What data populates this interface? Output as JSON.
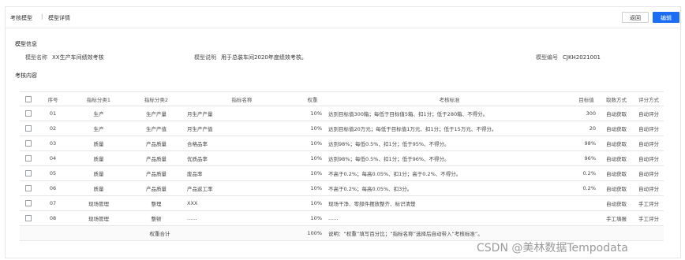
{
  "breadcrumb": {
    "item1": "考核模型",
    "separator": "|",
    "item2": "模型详情"
  },
  "actions": {
    "back_label": "返回",
    "edit_label": "编辑"
  },
  "sections": {
    "model_info": "模型信息",
    "assessment_content": "考核内容"
  },
  "model": {
    "name_label": "模型名称",
    "name_value": "XX生产车间绩效考核",
    "desc_label": "模型说明",
    "desc_value": "用于总装车间2020年度绩效考核。",
    "code_label": "模型编号",
    "code_value": "CJKH2021001"
  },
  "table": {
    "columns": [
      "序号",
      "指标分类1",
      "指标分类2",
      "指标名称",
      "权重",
      "考核标准",
      "目标值",
      "取数方式",
      "评分方式"
    ],
    "rows": [
      {
        "no": "01",
        "cat1": "生产",
        "cat2": "生产产量",
        "name": "月生产产量",
        "weight": "10%",
        "standard": "达到目标值300箱；每低于目标值5箱、扣1分；低于280箱、不得分。",
        "target": "300",
        "fetch": "自动获取",
        "score": "自动评分"
      },
      {
        "no": "02",
        "cat1": "生产",
        "cat2": "生产产值",
        "name": "月生产产值",
        "weight": "10%",
        "standard": "达到目标值20万元；每低于目标值1万元、扣1分；低于15万元、不得分。",
        "target": "20",
        "fetch": "自动获取",
        "score": "自动评分"
      },
      {
        "no": "03",
        "cat1": "质量",
        "cat2": "产品质量",
        "name": "合格品率",
        "weight": "10%",
        "standard": "达到98%；每低0.5%、扣1分；低于95%、不得分。",
        "target": "98%",
        "fetch": "自动获取",
        "score": "自动评分"
      },
      {
        "no": "04",
        "cat1": "质量",
        "cat2": "产品质量",
        "name": "优质品率",
        "weight": "10%",
        "standard": "达到98%；每低0.5%、扣1分；低于96%、不得分。",
        "target": "96%",
        "fetch": "自动获取",
        "score": "自动评分"
      },
      {
        "no": "05",
        "cat1": "质量",
        "cat2": "产品质量",
        "name": "废品率",
        "weight": "10%",
        "standard": "不高于0.2%；每高0.05%、扣1分；高于0.2%、不得分。",
        "target": "0.2%",
        "fetch": "自动获取",
        "score": "自动评分"
      },
      {
        "no": "06",
        "cat1": "质量",
        "cat2": "产品质量",
        "name": "产品返工率",
        "weight": "10%",
        "standard": "不高于0.2%；每高0.05%、扣3分。",
        "target": "0.2%",
        "fetch": "自动获取",
        "score": "自动评分"
      },
      {
        "no": "07",
        "cat1": "现场管理",
        "cat2": "整理",
        "name": "XXX",
        "weight": "10%",
        "standard": "现场干净、零部件摆放整齐、标识清楚",
        "target": "",
        "fetch": "自动获取",
        "score": "手工评分"
      },
      {
        "no": "08",
        "cat1": "现场管理",
        "cat2": "整顿",
        "name": "......",
        "weight": "10%",
        "standard": "......",
        "target": "",
        "fetch": "手工填报",
        "score": "手工评分"
      }
    ],
    "total": {
      "label": "权重合计",
      "weight": "100%",
      "note": "说明：“权重”填写百分比；“指标名称”选择后自动带入“考核标准”。"
    }
  },
  "watermark": "CSDN @美林数据Tempodata"
}
